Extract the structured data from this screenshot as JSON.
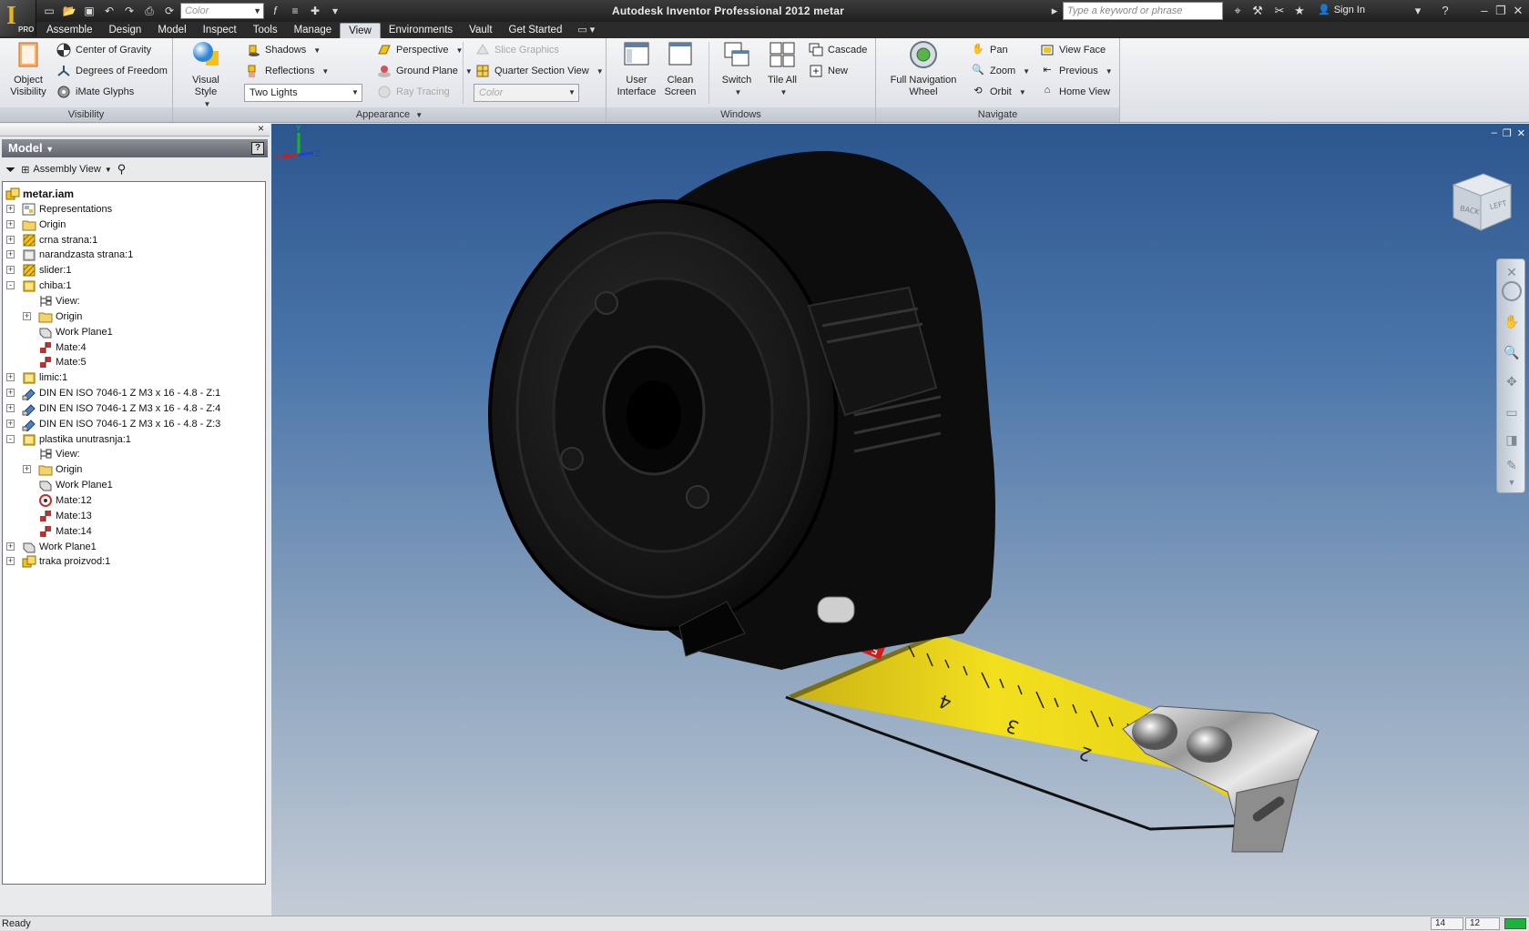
{
  "window": {
    "title": "Autodesk Inventor Professional 2012   metar",
    "logo_text": "PRO",
    "search_placeholder": "Type a keyword or phrase",
    "sign_in": "Sign In"
  },
  "quick_access": {
    "color_combo": "Color"
  },
  "tabs": [
    {
      "label": "Assemble"
    },
    {
      "label": "Design"
    },
    {
      "label": "Model"
    },
    {
      "label": "Inspect"
    },
    {
      "label": "Tools"
    },
    {
      "label": "Manage"
    },
    {
      "label": "View",
      "active": true
    },
    {
      "label": "Environments"
    },
    {
      "label": "Vault"
    },
    {
      "label": "Get Started"
    }
  ],
  "ribbon": {
    "visibility": {
      "title": "Visibility",
      "object_visibility": "Object\nVisibility",
      "center_of_gravity": "Center of Gravity",
      "degrees_of_freedom": "Degrees of Freedom",
      "imate_glyphs": "iMate Glyphs"
    },
    "appearance": {
      "title": "Appearance",
      "visual_style": "Visual Style",
      "shadows": "Shadows",
      "reflections": "Reflections",
      "lighting_combo": "Two Lights",
      "perspective": "Perspective",
      "ground_plane": "Ground Plane",
      "ray_tracing": "Ray Tracing",
      "slice_graphics": "Slice Graphics",
      "quarter_section_view": "Quarter Section View",
      "color_combo": "Color"
    },
    "windows": {
      "title": "Windows",
      "user_interface": "User\nInterface",
      "clean_screen": "Clean\nScreen",
      "switch": "Switch",
      "tile_all": "Tile All",
      "cascade": "Cascade",
      "new": "New"
    },
    "navigate": {
      "title": "Navigate",
      "full_navigation_wheel": "Full Navigation\nWheel",
      "pan": "Pan",
      "zoom": "Zoom",
      "orbit": "Orbit",
      "view_face": "View Face",
      "previous": "Previous",
      "home_view": "Home View"
    }
  },
  "browser": {
    "header": "Model",
    "view_selector": "Assembly View",
    "tree": [
      {
        "label": "metar.iam",
        "depth": 0,
        "icon": "assembly-icon",
        "root": true
      },
      {
        "label": "Representations",
        "depth": 0,
        "icon": "representations-icon",
        "expander": "+"
      },
      {
        "label": "Origin",
        "depth": 0,
        "icon": "folder-icon",
        "expander": "+"
      },
      {
        "label": "crna strana:1",
        "depth": 0,
        "icon": "part-icon",
        "expander": "+"
      },
      {
        "label": "narandzasta strana:1",
        "depth": 0,
        "icon": "part-grey-icon",
        "expander": "+"
      },
      {
        "label": "slider:1",
        "depth": 0,
        "icon": "part-icon",
        "expander": "+"
      },
      {
        "label": "chiba:1",
        "depth": 0,
        "icon": "subassembly-icon",
        "expander": "-"
      },
      {
        "label": "View:",
        "depth": 1,
        "icon": "view-rep-icon"
      },
      {
        "label": "Origin",
        "depth": 1,
        "icon": "folder-icon",
        "expander": "+"
      },
      {
        "label": "Work Plane1",
        "depth": 1,
        "icon": "work-plane-icon"
      },
      {
        "label": "Mate:4",
        "depth": 1,
        "icon": "mate-icon"
      },
      {
        "label": "Mate:5",
        "depth": 1,
        "icon": "mate-icon"
      },
      {
        "label": "limic:1",
        "depth": 0,
        "icon": "subassembly-icon",
        "expander": "+"
      },
      {
        "label": "DIN EN ISO 7046-1 Z M3 x 16 - 4.8 - Z:1",
        "depth": 0,
        "icon": "content-center-icon",
        "expander": "+"
      },
      {
        "label": "DIN EN ISO 7046-1 Z M3 x 16 - 4.8 - Z:4",
        "depth": 0,
        "icon": "content-center-icon",
        "expander": "+"
      },
      {
        "label": "DIN EN ISO 7046-1 Z M3 x 16 - 4.8 - Z:3",
        "depth": 0,
        "icon": "content-center-icon",
        "expander": "+"
      },
      {
        "label": "plastika unutrasnja:1",
        "depth": 0,
        "icon": "subassembly-icon",
        "expander": "-"
      },
      {
        "label": "View:",
        "depth": 1,
        "icon": "view-rep-icon"
      },
      {
        "label": "Origin",
        "depth": 1,
        "icon": "folder-icon",
        "expander": "+"
      },
      {
        "label": "Work Plane1",
        "depth": 1,
        "icon": "work-plane-icon"
      },
      {
        "label": "Mate:12",
        "depth": 1,
        "icon": "insert-icon"
      },
      {
        "label": "Mate:13",
        "depth": 1,
        "icon": "mate-icon"
      },
      {
        "label": "Mate:14",
        "depth": 1,
        "icon": "mate-icon"
      },
      {
        "label": "Work Plane1",
        "depth": 0,
        "icon": "work-plane-icon",
        "expander": "+"
      },
      {
        "label": "traka proizvod:1",
        "depth": 0,
        "icon": "assembly-icon",
        "expander": "+"
      }
    ]
  },
  "viewport": {
    "viewcube_labels": [
      "BACK",
      "LEFT"
    ],
    "triad_labels": {
      "x": "X",
      "y": "Y",
      "z": "Z"
    },
    "tape_numbers": [
      "5",
      "4",
      "3",
      "2"
    ]
  },
  "status": {
    "text": "Ready",
    "count1": "14",
    "count2": "12"
  },
  "colors": {
    "viewport_top": "#2c568e",
    "viewport_bottom": "#c4ccd6",
    "tape_yellow": "#e8d21a",
    "active_tab": "#dfe3e8"
  }
}
